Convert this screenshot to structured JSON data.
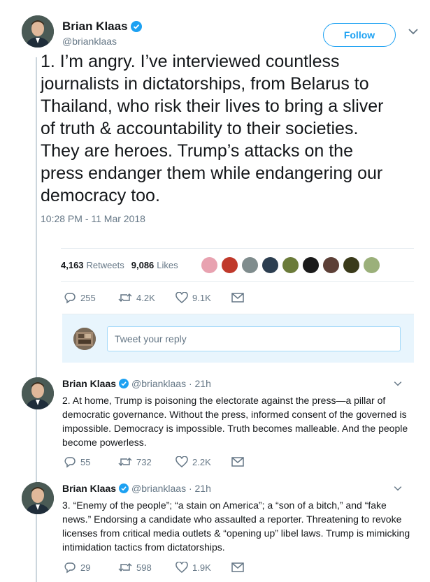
{
  "main_tweet": {
    "author_name": "Brian Klaas",
    "author_handle": "@brianklaas",
    "follow_label": "Follow",
    "text": "1. I’m angry. I’ve interviewed countless journalists in dictatorships, from Belarus to Thailand, who risk their lives to bring a sliver of truth & accountability to their societies. They are heroes. Trump’s attacks on the press endanger them while endangering our democracy too.",
    "timestamp": "10:28 PM - 11 Mar 2018",
    "retweets_count": "4,163",
    "retweets_label": "Retweets",
    "likes_count": "9,086",
    "likes_label": "Likes",
    "likers": [
      "#e8a2b0",
      "#c0392b",
      "#7f8c8d",
      "#2c3e50",
      "#6b7b3a",
      "#1a1a1a",
      "#5d4037",
      "#3a3a1a",
      "#9bb07a"
    ],
    "actions": {
      "replies": "255",
      "retweets": "4.2K",
      "likes": "9.1K"
    }
  },
  "reply_box": {
    "placeholder": "Tweet your reply"
  },
  "thread": [
    {
      "author_name": "Brian Klaas",
      "handle_time": "@brianklaas · 21h",
      "text": "2. At home, Trump is poisoning the electorate against the press—a pillar of democratic governance. Without the press, informed consent of the governed is impossible. Democracy is impossible. Truth becomes malleable. And the people become powerless.",
      "actions": {
        "replies": "55",
        "retweets": "732",
        "likes": "2.2K"
      }
    },
    {
      "author_name": "Brian Klaas",
      "handle_time": "@brianklaas · 21h",
      "text": "3. “Enemy of the people”; “a stain on America”; a “son of a bitch,” and “fake news.” Endorsing a candidate who assaulted a reporter. Threatening to revoke licenses from critical media outlets & “opening up” libel laws. Trump is mimicking intimidation tactics from dictatorships.",
      "actions": {
        "replies": "29",
        "retweets": "598",
        "likes": "1.9K"
      }
    }
  ],
  "colors": {
    "accent": "#1da1f2",
    "muted": "#657786",
    "reply_bg": "#e8f5fd"
  }
}
